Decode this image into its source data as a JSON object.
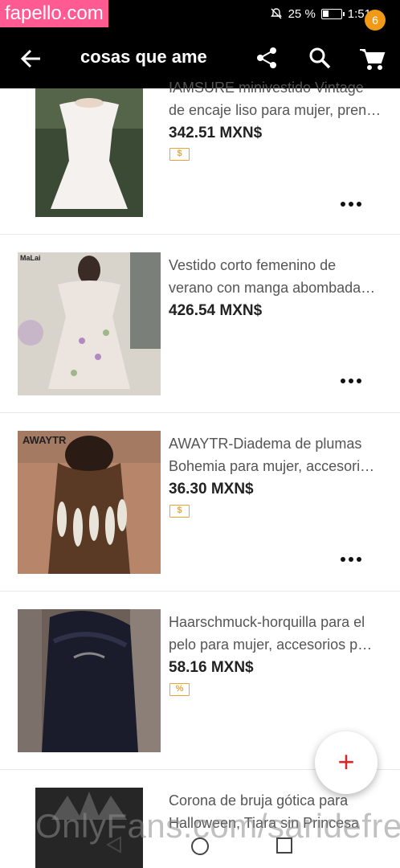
{
  "watermark_top": "fapello.com",
  "status": {
    "battery_percent": "25 %",
    "time": "1:51"
  },
  "appbar": {
    "title": "cosas que ame",
    "cart_count": "6",
    "icons": [
      "back-arrow-icon",
      "share-icon",
      "search-icon",
      "cart-icon"
    ]
  },
  "items": [
    {
      "title_lines": [
        "IAMSURE minivestido Vintage",
        "de encaje liso para mujer, pren…"
      ],
      "price": "342.51 MXN$",
      "badge": "$"
    },
    {
      "title_lines": [
        "Vestido corto femenino de",
        "verano con manga abombada…"
      ],
      "price": "426.54 MXN$",
      "thumb_label": "MaLai"
    },
    {
      "title_lines": [
        "AWAYTR-Diadema de plumas",
        "Bohemia para mujer, accesori…"
      ],
      "price": "36.30 MXN$",
      "badge": "$",
      "thumb_label": "AWAYTR"
    },
    {
      "title_lines": [
        "Haarschmuck-horquilla para el",
        "pelo para mujer, accesorios p…"
      ],
      "price": "58.16 MXN$",
      "badge": "%"
    },
    {
      "title_lines": [
        "Corona de bruja gótica para",
        "Halloween, Tiara sin Princesa"
      ]
    }
  ],
  "fab": {
    "symbol": "+"
  },
  "watermark_bottom": "OnlyFans.com/saridefree"
}
